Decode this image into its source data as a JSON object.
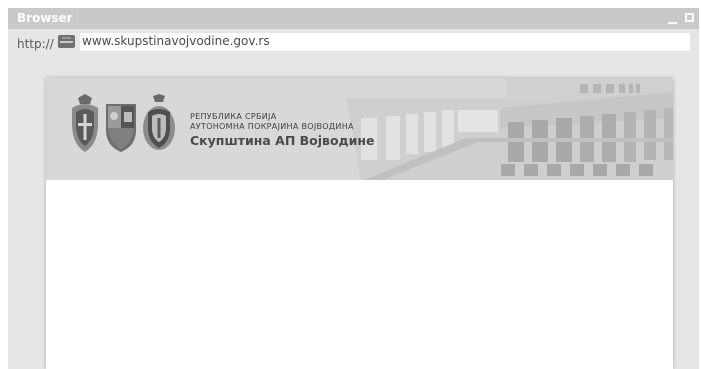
{
  "window": {
    "title": "Browser"
  },
  "address_bar": {
    "protocol": "http://",
    "url": "www.skupstinavojvodine.gov.rs",
    "favicon": "parliament-building-icon"
  },
  "site_header": {
    "logos": [
      "serbia-coat-of-arms",
      "vojvodina-coat-of-arms",
      "vojvodina-crest"
    ],
    "line1": "РЕПУБЛИКА СРБИЈА",
    "line2": "АУТОНОМНА ПОКРАЈИНА ВОЈВОДИНА",
    "line3": "Скупштина АП Војводине"
  },
  "colors": {
    "titlebar": "#c9c9c9",
    "window_bg": "#e6e6e6",
    "header_bg": "#d8d8d8"
  }
}
